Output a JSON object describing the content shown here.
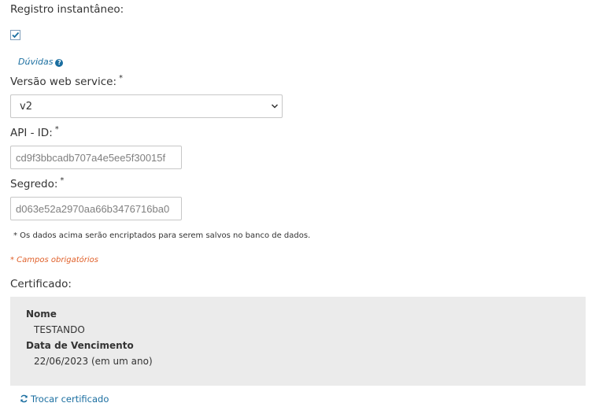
{
  "instant_register": {
    "label": "Registro instantâneo:",
    "checked": true,
    "help_link": "Dúvidas",
    "help_icon": "question-circle-icon"
  },
  "web_service": {
    "label": "Versão web service:",
    "required_mark": "*",
    "selected": "v2"
  },
  "api_id": {
    "label": "API - ID:",
    "required_mark": "*",
    "value": "cd9f3bbcadb707a4e5ee5f30015f"
  },
  "secret": {
    "label": "Segredo:",
    "required_mark": "*",
    "value": "d063e52a2970aa66b3476716ba0"
  },
  "encryption_note": "* Os dados acima serão encriptados para serem salvos no banco de dados.",
  "required_note": "* Campos obrigatórios",
  "certificate": {
    "label": "Certificado:",
    "name_key": "Nome",
    "name_value": "TESTANDO",
    "expiry_key": "Data de Vencimento",
    "expiry_value": "22/06/2023 (em um ano)",
    "swap_link": "Trocar certificado",
    "swap_icon": "refresh-icon"
  },
  "colors": {
    "link": "#1a6ea0",
    "required": "#e0612b",
    "panel": "#ebebeb",
    "check": "#1a6ea0"
  }
}
